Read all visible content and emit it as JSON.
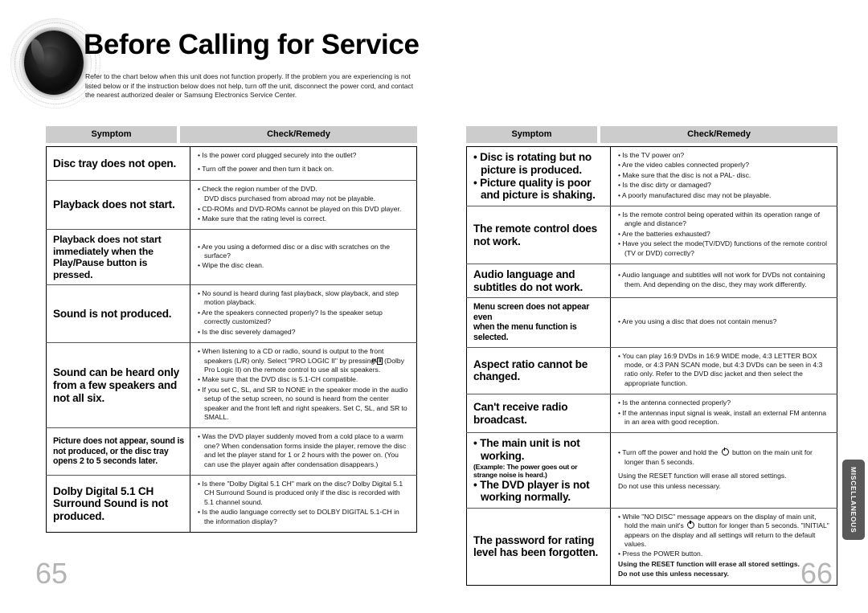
{
  "document": {
    "title": "Before Calling for Service",
    "intro": "Refer to the chart below when this unit does not function properly. If the problem you are experiencing is not listed below or if the instruction below does not help, turn off the unit, disconnect the power cord, and contact the nearest authorized dealer or Samsung Electronics Service Center.",
    "side_tab": "MISCELLANEOUS",
    "page_left": "65",
    "page_right": "66",
    "header_bg": "#cccccc",
    "side_tab_bg": "#595959",
    "page_number_color": "#b4b4b4"
  },
  "columns": {
    "symptom": "Symptom",
    "remedy": "Check/Remedy"
  },
  "left_table": [
    {
      "symptom": [
        "Disc tray does not open."
      ],
      "symptom_style": "normal",
      "remedy": [
        {
          "type": "bullet",
          "text": "Is the power cord plugged securely into the outlet?"
        },
        {
          "type": "spacer"
        },
        {
          "type": "bullet",
          "text": "Turn off the power and then turn it back on."
        }
      ]
    },
    {
      "symptom": [
        "Playback does not start."
      ],
      "symptom_style": "normal",
      "remedy": [
        {
          "type": "bullet",
          "text": "Check the region number of the DVD."
        },
        {
          "type": "plain",
          "text": "DVD discs purchased from abroad may not be playable.",
          "indent": true
        },
        {
          "type": "bullet",
          "text": "CD-ROMs and DVD-ROMs cannot be played on this DVD player."
        },
        {
          "type": "bullet",
          "text": "Make sure that the rating level is correct."
        }
      ]
    },
    {
      "symptom": [
        "Playback does not start",
        "immediately when the",
        "Play/Pause button is pressed."
      ],
      "symptom_style": "small",
      "remedy": [
        {
          "type": "bullet",
          "text": "Are you using a deformed disc or a disc with scratches on the surface?"
        },
        {
          "type": "bullet",
          "text": "Wipe the disc clean."
        }
      ]
    },
    {
      "symptom": [
        "Sound is not produced."
      ],
      "symptom_style": "normal",
      "remedy": [
        {
          "type": "bullet",
          "text": "No sound is heard during fast playback, slow playback, and step motion playback."
        },
        {
          "type": "bullet",
          "text": "Are the speakers connected properly? Is the speaker setup correctly customized?"
        },
        {
          "type": "bullet",
          "text": "Is the disc severely damaged?"
        }
      ]
    },
    {
      "symptom": [
        "Sound can be heard only",
        "from a few speakers and",
        "not all six."
      ],
      "symptom_style": "normal",
      "remedy": [
        {
          "type": "bullet-dolby",
          "pre": "When listening to a CD or radio, sound is output to the front speakers (L/R) only. Select \"PRO LOGIC II\" by pressing ",
          "glyph": "PL II",
          "post": " (Dolby Pro Logic II) on the remote control to use all six speakers."
        },
        {
          "type": "bullet",
          "text": "Make sure that the DVD disc is 5.1-CH compatible."
        },
        {
          "type": "bullet",
          "text": "If you set C, SL, and SR to NONE in the speaker mode in the audio setup of the setup screen, no sound is heard from the center speaker and the front left and right speakers. Set C, SL, and SR to SMALL."
        }
      ]
    },
    {
      "symptom": [
        "Picture does not appear, sound is",
        "not produced, or the disc tray",
        "opens 2 to 5 seconds later."
      ],
      "symptom_style": "xsmall",
      "remedy": [
        {
          "type": "bullet",
          "text": "Was the DVD player suddenly moved from a cold place to a warm one? When condensation forms inside the player, remove the disc and let the player stand for 1 or 2 hours with the power on. (You can use the player again after condensation disappears.)"
        }
      ]
    },
    {
      "symptom": [
        "Dolby Digital 5.1 CH",
        "Surround Sound is not",
        "produced."
      ],
      "symptom_style": "normal",
      "remedy": [
        {
          "type": "bullet",
          "text": "Is there \"Dolby Digital 5.1 CH\" mark on the disc? Dolby Digital 5.1 CH Surround Sound is produced only if the disc is recorded with 5.1 channel sound."
        },
        {
          "type": "bullet",
          "text": "Is the audio language correctly set to DOLBY DIGITAL 5.1-CH in the information display?"
        }
      ]
    }
  ],
  "right_table": [
    {
      "symptom": [
        "Disc is rotating but no picture is produced.",
        "Picture quality is poor and picture is shaking."
      ],
      "symptom_style": "bulleted",
      "remedy": [
        {
          "type": "bullet",
          "text": "Is the TV power on?"
        },
        {
          "type": "bullet",
          "text": "Are the video cables connected properly?"
        },
        {
          "type": "bullet",
          "text": "Make sure that the disc is not a PAL- disc."
        },
        {
          "type": "bullet",
          "text": "Is the disc dirty or damaged?"
        },
        {
          "type": "bullet",
          "text": "A poorly manufactured disc may not be playable."
        }
      ]
    },
    {
      "symptom": [
        "The remote control does",
        "not work."
      ],
      "symptom_style": "normal",
      "remedy": [
        {
          "type": "bullet",
          "text": "Is the remote control being operated within its operation range of angle and distance?"
        },
        {
          "type": "bullet",
          "text": "Are the batteries exhausted?"
        },
        {
          "type": "bullet",
          "text": "Have you select the mode(TV/DVD) functions of the remote control (TV or DVD) correctly?"
        }
      ]
    },
    {
      "symptom": [
        "Audio language and",
        "subtitles do not work."
      ],
      "symptom_style": "normal",
      "remedy": [
        {
          "type": "bullet",
          "text": "Audio language and subtitles will not work for DVDs not containing them. And depending on the disc, they may work differently."
        }
      ]
    },
    {
      "symptom": [
        "Menu screen does not appear even",
        "when the menu function is selected."
      ],
      "symptom_style": "xsmall",
      "remedy": [
        {
          "type": "bullet",
          "text": "Are you using a disc that does not contain menus?"
        }
      ]
    },
    {
      "symptom": [
        "Aspect ratio cannot be",
        "changed."
      ],
      "symptom_style": "normal",
      "remedy": [
        {
          "type": "bullet",
          "text": "You can play 16:9 DVDs in 16:9 WIDE mode, 4:3 LETTER BOX mode, or 4:3 PAN SCAN mode, but 4:3 DVDs can be seen in 4:3 ratio only. Refer to the DVD disc jacket and then select the appropriate function."
        }
      ]
    },
    {
      "symptom": [
        "Can't receive radio",
        "broadcast."
      ],
      "symptom_style": "normal",
      "remedy": [
        {
          "type": "bullet",
          "text": "Is the antenna connected properly?"
        },
        {
          "type": "bullet",
          "text": "If the antennas input signal is weak, install an external FM antenna in an area with good reception."
        }
      ]
    },
    {
      "symptom_mixed": [
        {
          "text": "The main unit is not working.",
          "bullet": true,
          "size": "normal"
        },
        {
          "text": "(Example: The power goes out or",
          "bullet": false,
          "size": "tiny"
        },
        {
          "text": "strange noise is heard.)",
          "bullet": false,
          "size": "tiny"
        },
        {
          "text": "The DVD player is not",
          "bullet": true,
          "size": "normal"
        },
        {
          "text": "working normally.",
          "bullet": false,
          "size": "normal",
          "indent": true
        }
      ],
      "symptom_style": "mixed",
      "remedy": [
        {
          "type": "bullet-power",
          "pre": "Turn off the power and hold the ",
          "post": " button on the main unit for longer than 5 seconds."
        },
        {
          "type": "spacer"
        },
        {
          "type": "plain",
          "text": "Using the RESET function will erase all stored settings."
        },
        {
          "type": "plain",
          "text": "Do not use this unless necessary."
        }
      ]
    },
    {
      "symptom": [
        "The password for rating",
        "level has been forgotten."
      ],
      "symptom_style": "normal",
      "remedy": [
        {
          "type": "bullet-power2",
          "pre": "While \"NO DISC\" message appears on the display of main unit, hold the main unit's ",
          "post": " button for longer than 5 seconds. \"INITIAL\" appears on the display and all settings will return to the default values."
        },
        {
          "type": "bullet",
          "text": "Press the POWER button."
        },
        {
          "type": "plain",
          "text": "Using the RESET function will erase all stored settings.",
          "bold": true
        },
        {
          "type": "plain",
          "text": "Do not use this unless necessary.",
          "bold": true
        }
      ]
    }
  ]
}
